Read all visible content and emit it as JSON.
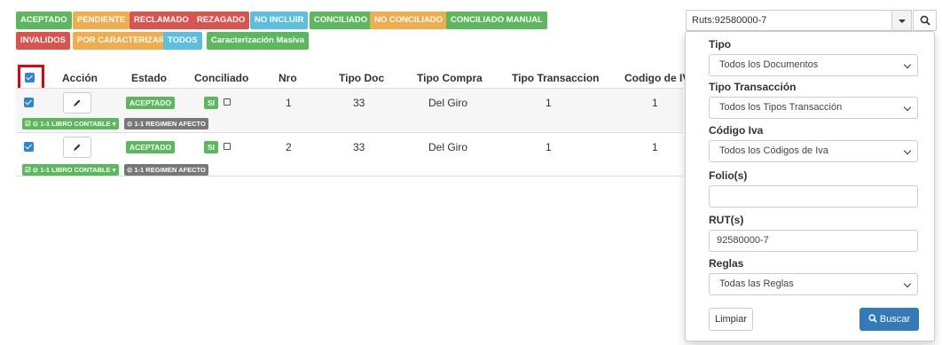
{
  "filters": {
    "row1": [
      {
        "label": "ACEPTADO",
        "color": "#5cb85c"
      },
      {
        "label": "PENDIENTE",
        "color": "#f0ad4e"
      },
      {
        "label": "RECLAMADO",
        "color": "#d9534f"
      },
      {
        "label": "REZAGADO",
        "color": "#d9534f"
      },
      {
        "label": "NO INCLUIR",
        "color": "#5bc0de"
      },
      {
        "label": "CONCILIADO",
        "color": "#5cb85c"
      },
      {
        "label": "NO CONCILIADO",
        "color": "#f0ad4e"
      },
      {
        "label": "CONCILIADO MANUAL",
        "color": "#5cb85c"
      }
    ],
    "row2": [
      {
        "label": "INVALIDOS",
        "color": "#d9534f"
      },
      {
        "label": "POR CARACTERIZAR",
        "color": "#f0ad4e"
      },
      {
        "label": "TODOS",
        "color": "#5bc0de"
      },
      {
        "label": "Caracterización Masiva",
        "color": "#5cb85c"
      }
    ]
  },
  "table": {
    "headers": [
      "Acción",
      "Estado",
      "Conciliado",
      "Nro",
      "Tipo Doc",
      "Tipo Compra",
      "Tipo Transaccion",
      "Codigo de IVA"
    ],
    "rows": [
      {
        "estado": "ACEPTADO",
        "conciliado": "SI",
        "nro": "1",
        "tipo_doc": "33",
        "tipo_compra": "Del Giro",
        "tipo_transaccion": "1",
        "codigo_iva": "1",
        "tags": [
          "1-1 LIBRO CONTABLE",
          "1-1 REGIMEN AFECTO"
        ]
      },
      {
        "estado": "ACEPTADO",
        "conciliado": "SI",
        "nro": "2",
        "tipo_doc": "33",
        "tipo_compra": "Del Giro",
        "tipo_transaccion": "1",
        "codigo_iva": "1",
        "tags": [
          "1-1 LIBRO CONTABLE",
          "1-1 REGIMEN AFECTO"
        ]
      }
    ]
  },
  "search": {
    "ruts_selected": "Ruts:92580000-7"
  },
  "panel": {
    "tipo_label": "Tipo",
    "tipo_value": "Todos los Documentos",
    "tipo_transaccion_label": "Tipo Transacción",
    "tipo_transaccion_value": "Todos los Tipos Transacción",
    "codigo_iva_label": "Código Iva",
    "codigo_iva_value": "Todos los Códigos de Iva",
    "folios_label": "Folio(s)",
    "folios_value": "",
    "rut_label": "RUT(s)",
    "rut_value": "92580000-7",
    "reglas_label": "Reglas",
    "reglas_value": "Todas las Reglas",
    "limpiar_label": "Limpiar",
    "buscar_label": "Buscar"
  },
  "colors": {
    "primary": "#337ab7",
    "success": "#5cb85c",
    "warning": "#f0ad4e",
    "danger": "#d9534f",
    "info": "#5bc0de",
    "highlight_box": "#e0000f",
    "label_default": "#777777"
  },
  "icons": {
    "edit": "pencil-icon",
    "search": "magnifier-icon",
    "dropdown": "caret-down-icon"
  }
}
